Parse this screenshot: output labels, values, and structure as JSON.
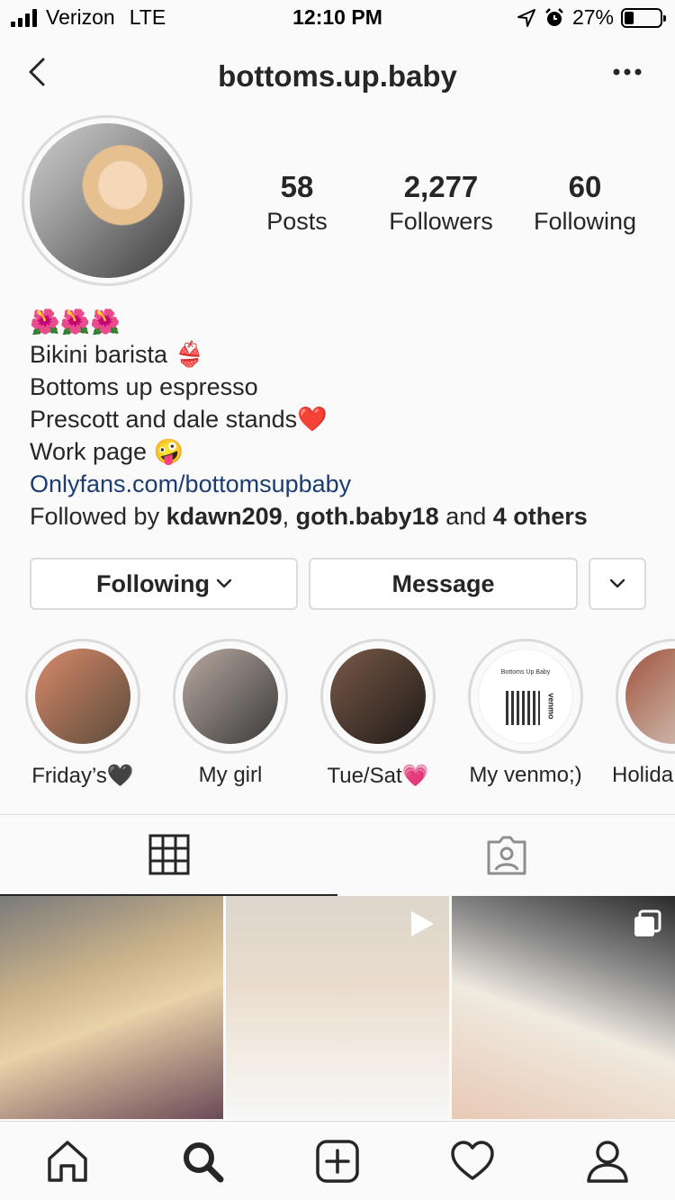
{
  "status_bar": {
    "carrier": "Verizon",
    "network": "LTE",
    "time": "12:10 PM",
    "battery": "27%",
    "battery_level": 0.27
  },
  "header": {
    "username": "bottoms.up.baby",
    "back_icon": "chevron-left-icon",
    "more_icon": "more-horizontal-icon"
  },
  "profile": {
    "stats": [
      {
        "value": "58",
        "label": "Posts"
      },
      {
        "value": "2,277",
        "label": "Followers"
      },
      {
        "value": "60",
        "label": "Following"
      }
    ],
    "bio": {
      "emoji_line": "🌺🌺🌺",
      "line1": "Bikini barista 👙",
      "line2": "Bottoms up espresso",
      "line3": "Prescott and dale stands❤️",
      "line4": "Work page 🤪",
      "link": "Onlyfans.com/bottomsupbaby",
      "followed_prefix": "Followed by ",
      "follower1": "kdawn209",
      "comma": ", ",
      "follower2": "goth.baby18",
      "and": " and ",
      "others": "4 others"
    }
  },
  "buttons": {
    "following": "Following",
    "message": "Message"
  },
  "highlights": [
    {
      "label": "Friday’s🖤",
      "color1": "#d98a6a",
      "color2": "#5a4a3a"
    },
    {
      "label": "My girl",
      "color1": "#b8a9a0",
      "color2": "#3a3a3a"
    },
    {
      "label": "Tue/Sat💗",
      "color1": "#7a5a48",
      "color2": "#1e1a18"
    },
    {
      "label": "My venmo;)",
      "color1": "#ffffff",
      "color2": "#e6e6e6",
      "inner_title": "Bottoms Up Baby",
      "inner_badge": "venmo"
    },
    {
      "label": "Holida",
      "color1": "#a0543c",
      "color2": "#d8d0c8"
    }
  ],
  "tabs": {
    "grid_icon": "grid-icon",
    "tagged_icon": "tagged-person-icon"
  },
  "posts": [
    {
      "icon": ""
    },
    {
      "icon": "play-icon"
    },
    {
      "icon": "carousel-icon"
    }
  ],
  "bottom_nav": [
    "home-icon",
    "search-icon",
    "add-post-icon",
    "heart-icon",
    "profile-icon"
  ]
}
